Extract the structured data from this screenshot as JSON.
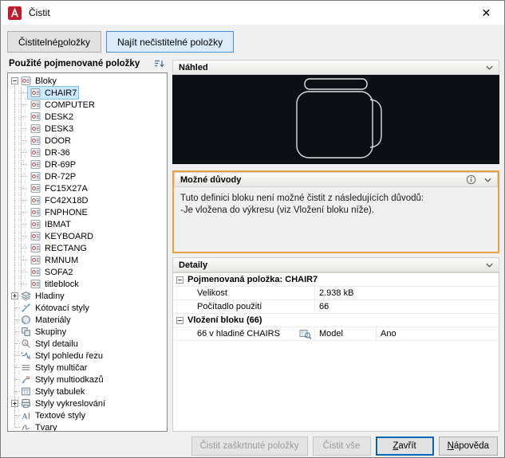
{
  "window": {
    "title": "Čistit",
    "close_glyph": "✕"
  },
  "tabs": {
    "purgeable": {
      "pre": "Čistitelné ",
      "key": "p",
      "post": "oložky"
    },
    "non_purgeable": {
      "label": "Najít nečistitelné položky"
    }
  },
  "tree": {
    "header": "Použité pojmenované položky",
    "root_label": "Bloky",
    "selected_block": "CHAIR7",
    "blocks": [
      "CHAIR7",
      "COMPUTER",
      "DESK2",
      "DESK3",
      "DOOR",
      "DR-36",
      "DR-69P",
      "DR-72P",
      "FC15X27A",
      "FC42X18D",
      "FNPHONE",
      "IBMAT",
      "KEYBOARD",
      "RECTANG",
      "RMNUM",
      "SOFA2",
      "titleblock"
    ],
    "categories": [
      {
        "label": "Hladiny",
        "icon": "layers-icon",
        "expandable": true
      },
      {
        "label": "Kótovací styly",
        "icon": "dimstyle-icon",
        "expandable": false
      },
      {
        "label": "Materiály",
        "icon": "materials-icon",
        "expandable": false
      },
      {
        "label": "Skupiny",
        "icon": "groups-icon",
        "expandable": false
      },
      {
        "label": "Styl detailu",
        "icon": "detail-style-icon",
        "expandable": false
      },
      {
        "label": "Styl pohledu řezu",
        "icon": "section-style-icon",
        "expandable": false
      },
      {
        "label": "Styly multičar",
        "icon": "mline-style-icon",
        "expandable": false
      },
      {
        "label": "Styly multiodkazů",
        "icon": "mleader-style-icon",
        "expandable": false
      },
      {
        "label": "Styly tabulek",
        "icon": "table-style-icon",
        "expandable": false
      },
      {
        "label": "Styly vykreslování",
        "icon": "plot-style-icon",
        "expandable": true
      },
      {
        "label": "Textové styly",
        "icon": "text-style-icon",
        "expandable": false
      },
      {
        "label": "Tvary",
        "icon": "shapes-icon",
        "expandable": false
      }
    ]
  },
  "preview": {
    "header": "Náhled"
  },
  "reasons": {
    "header": "Možné důvody",
    "line1": "Tuto definici bloku není možné čistit z následujících důvodů:",
    "line2": "-Je vložena do výkresu (viz Vložení bloku níže)."
  },
  "details": {
    "header": "Detaily",
    "named_item_header": "Pojmenovaná položka: CHAIR7",
    "size_label": "Velikost",
    "size_value": "2.938 kB",
    "usage_label": "Počítadlo použití",
    "usage_value": "66",
    "insert_header": "Vložení bloku (66)",
    "insert_label": "66 v hladině CHAIRS",
    "insert_space": "Model",
    "insert_flag": "Ano"
  },
  "footer": {
    "purge_checked": {
      "label": "Čistit zaškrtnuté položky",
      "disabled": true
    },
    "purge_all": {
      "label": "Čistit vše",
      "disabled": true
    },
    "close": {
      "pre": "",
      "key": "Z",
      "post": "avřít"
    },
    "help": {
      "pre": "",
      "key": "N",
      "post": "ápověda"
    }
  },
  "colors": {
    "highlight_orange": "#e7a33d",
    "selection_blue": "#cce8ff",
    "accent_blue": "#0067b8",
    "autocad_red": "#c21c2c",
    "preview_background": "#0c1014"
  }
}
